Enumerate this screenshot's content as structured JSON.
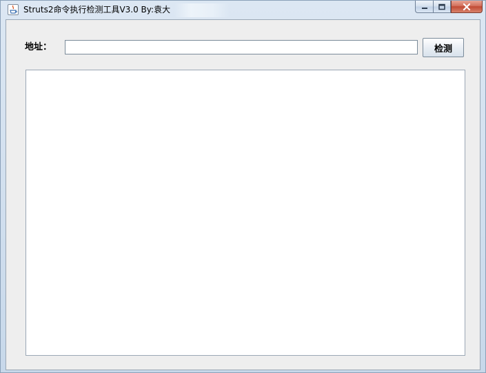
{
  "window": {
    "title": "Struts2命令执行检测工具V3.0  By:袁大"
  },
  "caption_buttons": {
    "minimize_icon": "minimize-icon",
    "maximize_icon": "maximize-icon",
    "close_icon": "close-icon"
  },
  "form": {
    "address_label": "地址：",
    "address_value": "",
    "detect_button_label": "检测"
  },
  "output": {
    "text": ""
  },
  "colors": {
    "close_button": "#c04a33",
    "client_background": "#eeeeee",
    "titlebar": "#dce7f3"
  }
}
